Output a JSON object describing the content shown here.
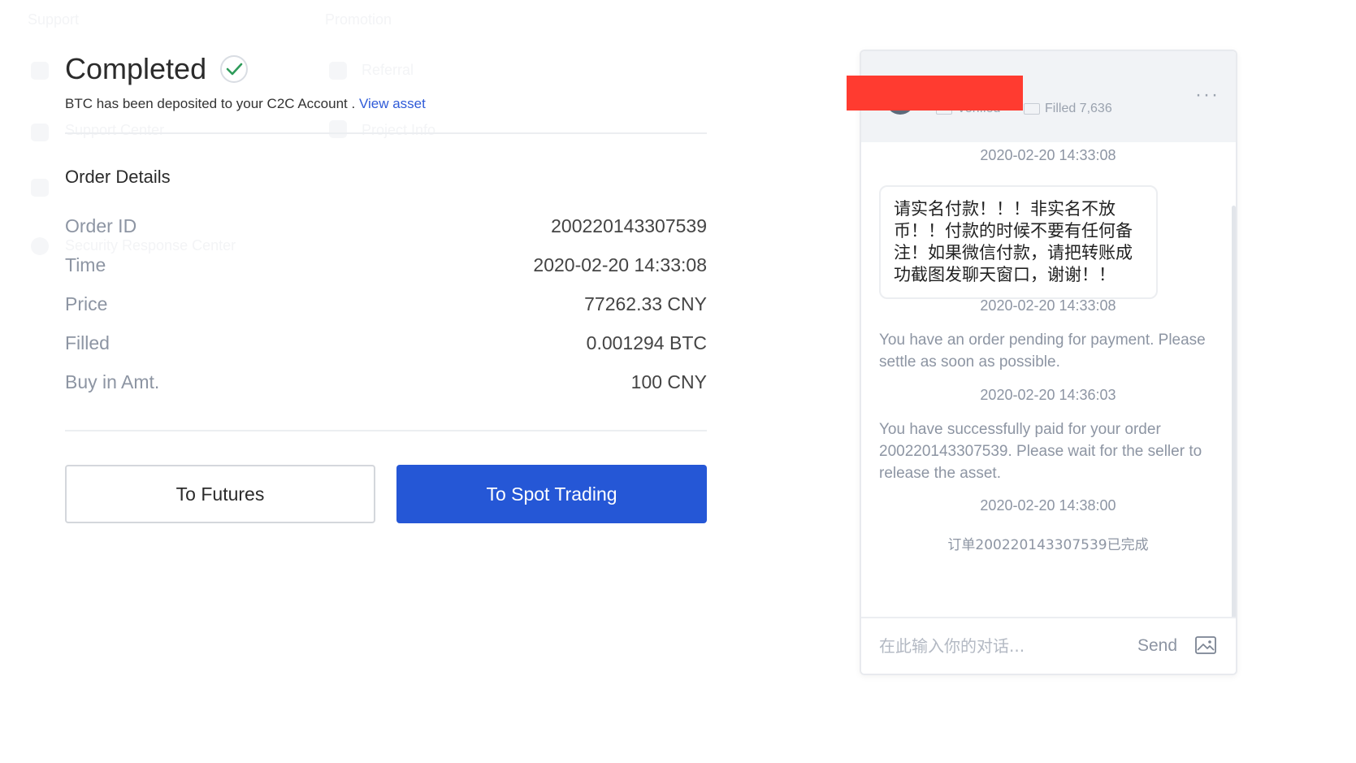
{
  "background": {
    "col1_heading": "Support",
    "col2_heading": "Promotion",
    "col1_items": [
      "Support Center",
      "Security Response Center"
    ],
    "col2_items": [
      "Referral",
      "Project Info"
    ]
  },
  "order": {
    "status_title": "Completed",
    "message": "BTC has been deposited to your C2C Account .",
    "view_asset_link": "View asset",
    "details_title": "Order Details",
    "rows": [
      {
        "label": "Order ID",
        "value": "200220143307539"
      },
      {
        "label": "Time",
        "value": "2020-02-20 14:33:08"
      },
      {
        "label": "Price",
        "value": "77262.33 CNY"
      },
      {
        "label": "Filled",
        "value": "0.001294 BTC"
      },
      {
        "label": "Buy in Amt.",
        "value": "100 CNY"
      }
    ],
    "buttons": {
      "futures": "To Futures",
      "spot": "To Spot Trading"
    }
  },
  "chat": {
    "header": {
      "verified": "Verified",
      "filled": "Filled 7,636",
      "more": "···"
    },
    "messages": [
      {
        "time": "2020-02-20 14:33:08",
        "text": "请实名付款！！！非实名不放币！！付款的时候不要有任何备注！如果微信付款，请把转账成功截图发聊天窗口，谢谢！！"
      },
      {
        "time": "2020-02-20 14:33:08",
        "text": "You have an order pending for payment. Please settle as soon as possible."
      },
      {
        "time": "2020-02-20 14:36:03",
        "text": "You have successfully paid for your order 200220143307539. Please wait for the seller to release the asset."
      },
      {
        "time": "2020-02-20 14:38:00",
        "text": "订单200220143307539已完成"
      }
    ],
    "input_placeholder": "在此输入你的对话...",
    "send_label": "Send"
  },
  "colors": {
    "primary": "#2557d6",
    "link": "#2f5bd8",
    "success": "#2e9b5a",
    "redaction": "#ff3b30"
  }
}
